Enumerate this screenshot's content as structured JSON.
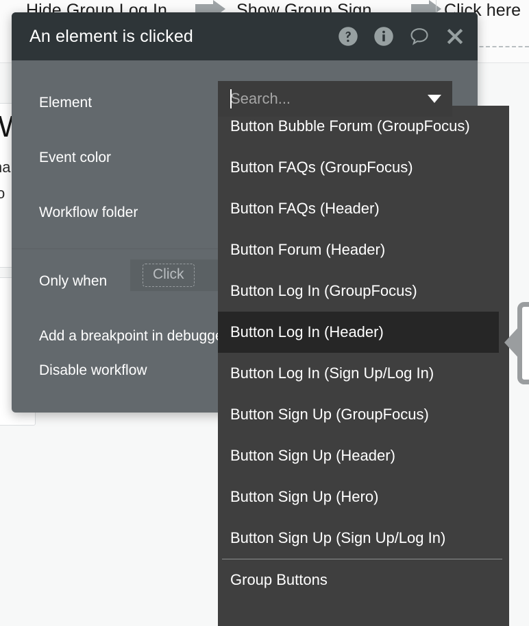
{
  "background": {
    "workflow_steps": [
      "Hide Group Log In",
      "Show Group Sign ...",
      "Click here"
    ],
    "left_card": {
      "title": "W",
      "line1": "ha",
      "line2": "o"
    },
    "arrow_icon": "arrow-right-icon"
  },
  "panel": {
    "title": "An element is clicked",
    "header_icons": [
      {
        "name": "help-icon",
        "glyph": "?"
      },
      {
        "name": "info-icon",
        "glyph": "i"
      },
      {
        "name": "comment-icon",
        "glyph": "speech-bubble"
      },
      {
        "name": "close-icon",
        "glyph": "x"
      }
    ],
    "fields": [
      {
        "key": "element",
        "label": "Element"
      },
      {
        "key": "event_color",
        "label": "Event color"
      },
      {
        "key": "workflow_folder",
        "label": "Workflow folder"
      }
    ],
    "conditions": {
      "only_when_label": "Only when",
      "only_when_value": "Click"
    },
    "options": [
      {
        "key": "breakpoint",
        "label": "Add a breakpoint in debugger"
      },
      {
        "key": "disable",
        "label": "Disable workflow"
      }
    ]
  },
  "dropdown": {
    "search_placeholder": "Search...",
    "search_value": "",
    "caret_icon": "chevron-down-icon",
    "selected_item": "Button Log In (Header)",
    "items": [
      {
        "label": "Button Bubble Forum (GroupFocus)",
        "selected": false,
        "separator_after": false
      },
      {
        "label": "Button FAQs (GroupFocus)",
        "selected": false,
        "separator_after": false
      },
      {
        "label": "Button FAQs (Header)",
        "selected": false,
        "separator_after": false
      },
      {
        "label": "Button Forum (Header)",
        "selected": false,
        "separator_after": false
      },
      {
        "label": "Button Log In (GroupFocus)",
        "selected": false,
        "separator_after": false
      },
      {
        "label": "Button Log In (Header)",
        "selected": true,
        "separator_after": false
      },
      {
        "label": "Button Log In (Sign Up/Log In)",
        "selected": false,
        "separator_after": false
      },
      {
        "label": "Button Sign Up (GroupFocus)",
        "selected": false,
        "separator_after": false
      },
      {
        "label": "Button Sign Up (Header)",
        "selected": false,
        "separator_after": false
      },
      {
        "label": "Button Sign Up (Hero)",
        "selected": false,
        "separator_after": false
      },
      {
        "label": "Button Sign Up (Sign Up/Log In)",
        "selected": false,
        "separator_after": true
      },
      {
        "label": "Group Buttons",
        "selected": false,
        "separator_after": false
      }
    ]
  },
  "colors": {
    "panel_body": "#63696d",
    "panel_header": "#2e3538",
    "dropdown_bg": "#3f3f3f",
    "dropdown_search_bg": "#3c3c3c",
    "dropdown_selected_bg": "#262626",
    "icon_gray": "#97a0a1",
    "callout_border": "#9a9d9f",
    "scrollbar_thumb": "#7f8183"
  }
}
